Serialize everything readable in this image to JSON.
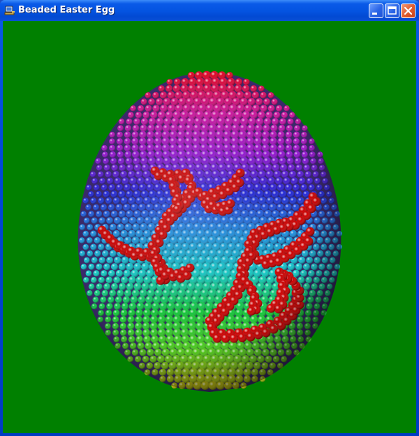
{
  "window": {
    "title": "Beaded Easter Egg",
    "icon": "computer-app-icon",
    "controls": {
      "minimize_icon": "minimize-icon",
      "maximize_icon": "maximize-icon",
      "close_icon": "close-icon"
    }
  },
  "scene": {
    "background_color": "#008000",
    "bead_pattern_color": "#cc0000",
    "bead_gradient": [
      "#e0001a",
      "#d0129a",
      "#9a12d0",
      "#2020d8",
      "#1a8ae0",
      "#10c8c8",
      "#10c838",
      "#50c818",
      "#c8b000"
    ]
  }
}
